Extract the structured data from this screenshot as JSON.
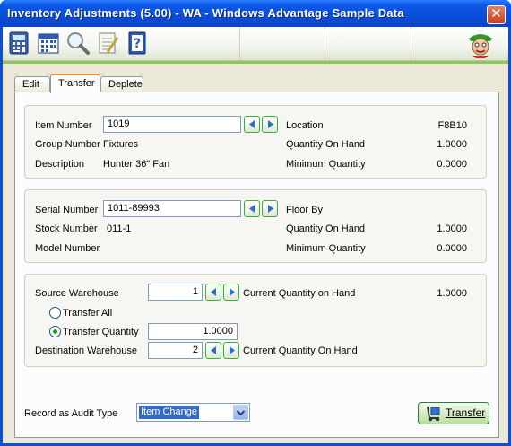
{
  "window": {
    "title": "Inventory Adjustments (5.00) - WA - Windows Advantage Sample Data",
    "close_glyph": "✕"
  },
  "toolbar": {
    "buttons": [
      {
        "icon": "calculator-icon"
      },
      {
        "icon": "calendar-icon"
      },
      {
        "icon": "magnifier-icon"
      },
      {
        "icon": "notepad-icon"
      },
      {
        "icon": "help-book-icon"
      }
    ],
    "logo_icon": "mascot-logo-icon"
  },
  "tabs": [
    "Edit",
    "Transfer",
    "Deplete"
  ],
  "item": {
    "number_label": "Item Number",
    "number_value": "1019",
    "group_label": "Group Number",
    "group_value": "Fixtures",
    "description_label": "Description",
    "description_value": "Hunter 36\" Fan",
    "location_label": "Location",
    "location_value": "F8B10",
    "qoh_label": "Quantity On Hand",
    "qoh_value": "1.0000",
    "min_label": "Minimum Quantity",
    "min_value": "0.0000"
  },
  "serial": {
    "serial_label": "Serial Number",
    "serial_value": "1011-89993",
    "stock_label": "Stock Number",
    "stock_value": "011-1",
    "model_label": "Model Number",
    "floor_label": "Floor By",
    "qoh_label": "Quantity On Hand",
    "qoh_value": "1.0000",
    "min_label": "Minimum Quantity",
    "min_value": "0.0000"
  },
  "warehouse": {
    "source_label": "Source Warehouse",
    "source_value": "1",
    "current_label": "Current Quantity on Hand",
    "current_value": "1.0000",
    "transfer_all_label": "Transfer All",
    "transfer_qty_label": "Transfer Quantity",
    "transfer_qty_value": "1.0000",
    "dest_label": "Destination Warehouse",
    "dest_value": "2",
    "dest_current_label": "Current Quantity On Hand",
    "selected_option": "Transfer Quantity"
  },
  "audit": {
    "label": "Record as Audit Type",
    "selected": "Item Change"
  },
  "actions": {
    "transfer_label": "Transfer"
  }
}
